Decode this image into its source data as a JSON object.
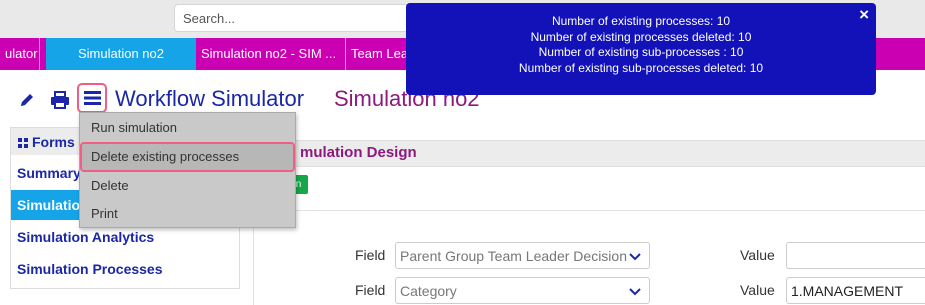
{
  "search": {
    "placeholder": "Search..."
  },
  "tabs": [
    {
      "label": "ulator"
    },
    {
      "label": "Simulation no2"
    },
    {
      "label": "Simulation no2 - SIM ..."
    },
    {
      "label": "Team Lea"
    }
  ],
  "header": {
    "app_title": "Workflow Simulator",
    "doc_title": "Simulation no2"
  },
  "menu": {
    "items": [
      {
        "label": "Run simulation"
      },
      {
        "label": "Delete existing processes"
      },
      {
        "label": "Delete"
      },
      {
        "label": "Print"
      }
    ]
  },
  "sidebar": {
    "heading": "Forms",
    "items": [
      {
        "label": "Summary"
      },
      {
        "label": "Simulation"
      },
      {
        "label": "Simulation Analytics"
      },
      {
        "label": "Simulation Processes"
      }
    ]
  },
  "main": {
    "section_title": "mulation Design",
    "action_button_label": "n",
    "rows": [
      {
        "field_label": "Field",
        "field_value": "Parent Group Team Leader Decision",
        "value_label": "Value",
        "value": ""
      },
      {
        "field_label": "Field",
        "field_value": "Category",
        "value_label": "Value",
        "value": "1.MANAGEMENT"
      }
    ]
  },
  "toast": {
    "lines": [
      "Number of existing processes: 10",
      "Number of existing processes deleted: 10",
      "Number of existing sub-processes : 10",
      "Number of existing sub-processes deleted: 10"
    ],
    "close": "×"
  },
  "colors": {
    "tab_bar": "#cc00b3",
    "tab_active": "#16a4e8",
    "toast_bg": "#1212b8",
    "title_blue": "#1a27a6",
    "title_purple": "#8c1a7e",
    "highlight_outline": "#f25d86"
  }
}
